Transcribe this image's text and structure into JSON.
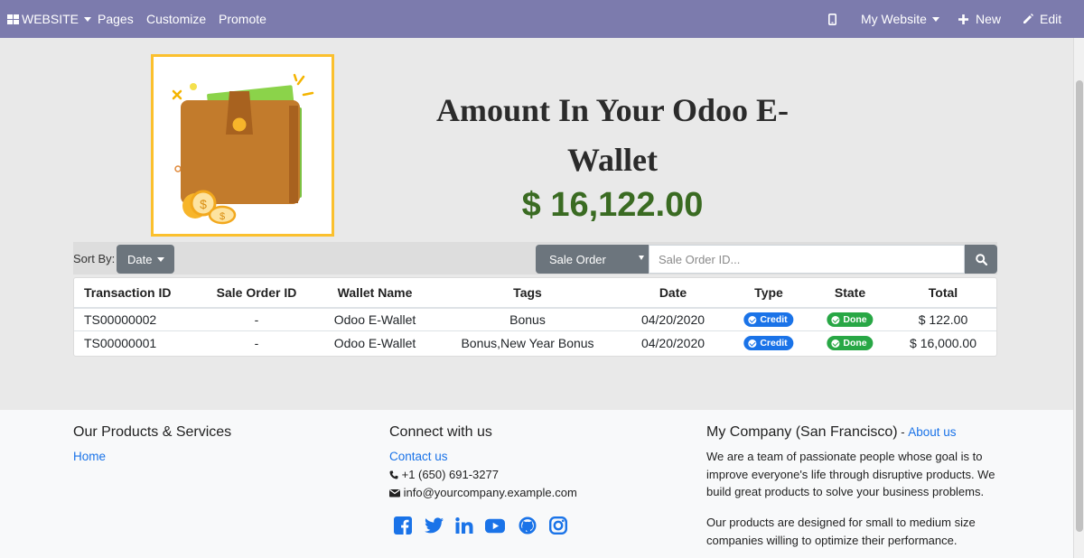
{
  "topbar": {
    "website_label": "WEBSITE",
    "pages_label": "Pages",
    "customize_label": "Customize",
    "promote_label": "Promote",
    "my_website_label": "My Website",
    "new_label": "New",
    "edit_label": "Edit"
  },
  "hero": {
    "title": "Amount In Your Odoo E-Wallet",
    "amount": "$ 16,122.00"
  },
  "toolbar": {
    "sort_label": "Sort By:",
    "sort_value": "Date",
    "filter_value": "Sale Order",
    "search_placeholder": "Sale Order ID..."
  },
  "table": {
    "headers": [
      "Transaction ID",
      "Sale Order ID",
      "Wallet Name",
      "Tags",
      "Date",
      "Type",
      "State",
      "Total"
    ],
    "rows": [
      {
        "transaction_id": "TS00000002",
        "sale_order_id": "-",
        "wallet_name": "Odoo E-Wallet",
        "tags": "Bonus",
        "date": "04/20/2020",
        "type": "Credit",
        "state": "Done",
        "total": "$ 122.00"
      },
      {
        "transaction_id": "TS00000001",
        "sale_order_id": "-",
        "wallet_name": "Odoo E-Wallet",
        "tags": "Bonus,New Year Bonus",
        "date": "04/20/2020",
        "type": "Credit",
        "state": "Done",
        "total": "$ 16,000.00"
      }
    ]
  },
  "footer": {
    "col1": {
      "title": "Our Products & Services",
      "home_link": "Home"
    },
    "col2": {
      "title": "Connect with us",
      "contact_link": "Contact us",
      "phone": "+1 (650) 691-3277",
      "email": "info@yourcompany.example.com",
      "social_icons": [
        "facebook-icon",
        "twitter-icon",
        "linkedin-icon",
        "youtube-icon",
        "github-icon",
        "instagram-icon"
      ]
    },
    "col3": {
      "title": "My Company (San Francisco)",
      "separator": " - ",
      "about_link": "About us",
      "para1": "We are a team of passionate people whose goal is to improve everyone's life through disruptive products. We build great products to solve your business problems.",
      "para2": "Our products are designed for small to medium size companies willing to optimize their performance."
    }
  },
  "colors": {
    "topbar": "#7c7bad",
    "amount": "#3a6b22",
    "link": "#1a73e8",
    "credit_badge": "#1a73e8",
    "done_badge": "#28a745",
    "wallet_border": "#fbc02d"
  }
}
